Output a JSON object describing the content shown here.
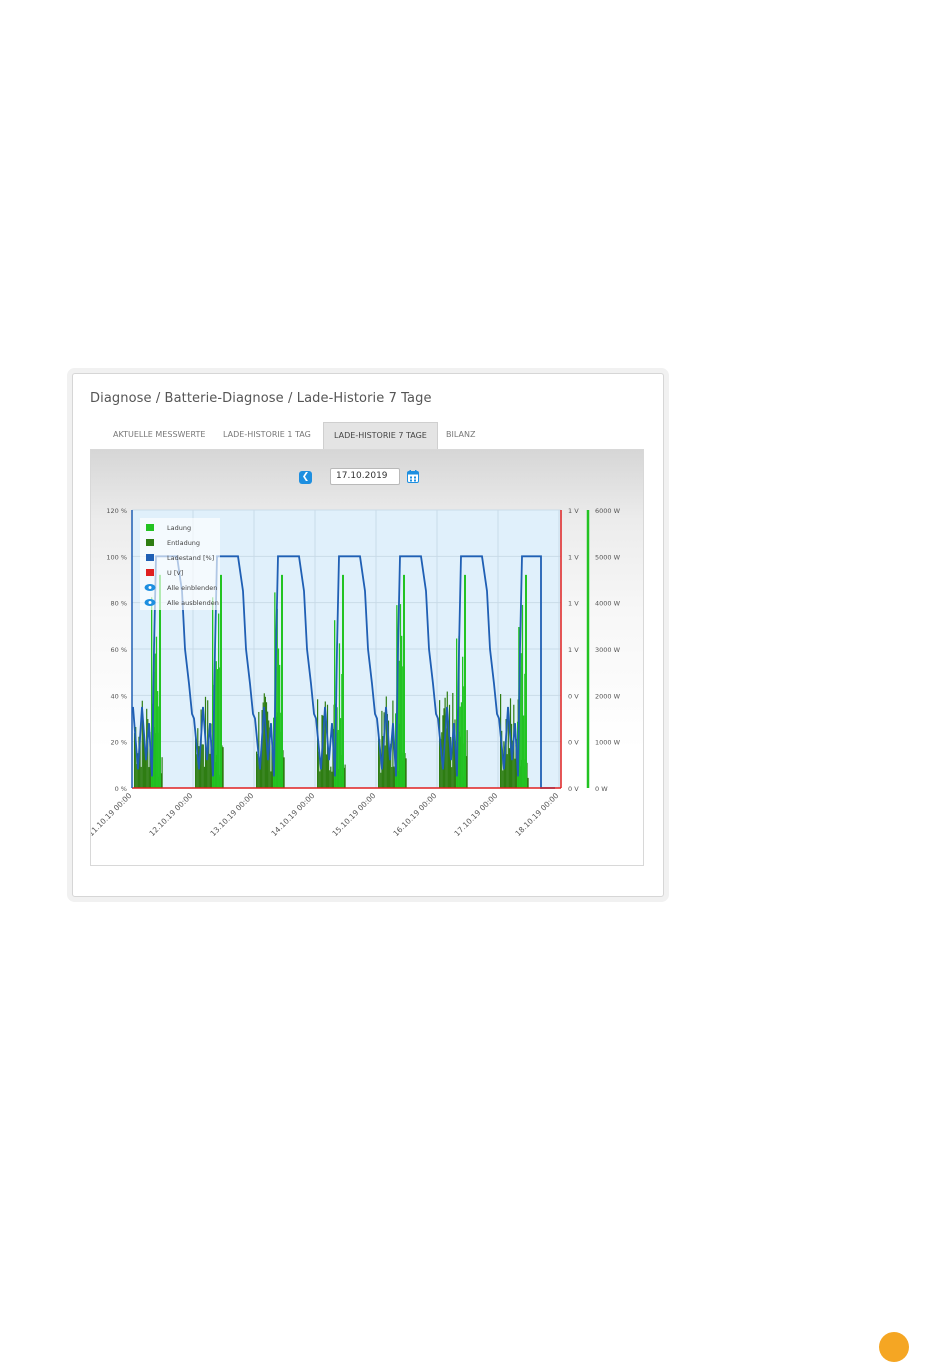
{
  "breadcrumb": "Diagnose / Batterie-Diagnose / Lade-Historie 7 Tage",
  "tabs": [
    {
      "label": "AKTUELLE MESSWERTE",
      "active": false
    },
    {
      "label": "LADE-HISTORIE 1 TAG",
      "active": false
    },
    {
      "label": "LADE-HISTORIE 7 TAGE",
      "active": true
    },
    {
      "label": "BILANZ",
      "active": false
    }
  ],
  "date_value": "17.10.2019",
  "icons": {
    "prev": "chevron-left-icon",
    "calendar": "calendar-icon"
  },
  "colors": {
    "ladung": "#22c322",
    "entladung": "#2e7d12",
    "ladestand": "#1f5fb4",
    "voltage": "#e02020",
    "accent": "#1e8fe0",
    "page_dot": "#f5a623"
  },
  "chart_data": {
    "type": "area",
    "x_tick_labels": [
      "11.10.19 00:00",
      "12.10.19 00:00",
      "13.10.19 00:00",
      "14.10.19 00:00",
      "15.10.19 00:00",
      "16.10.19 00:00",
      "17.10.19 00:00",
      "18.10.19 00:00"
    ],
    "axes": {
      "left": {
        "ticks": [
          "0 %",
          "20 %",
          "40 %",
          "60 %",
          "80 %",
          "100 %",
          "120 %"
        ],
        "range": [
          0,
          120
        ]
      },
      "right1": {
        "ticks": [
          "0 V",
          "0 V",
          "0 V",
          "1 V",
          "1 V",
          "1 V",
          "1 V"
        ]
      },
      "right2": {
        "ticks": [
          "0 W",
          "1000 W",
          "2000 W",
          "3000 W",
          "4000 W",
          "5000 W",
          "6000 W"
        ],
        "range": [
          0,
          6000
        ]
      }
    },
    "legend": {
      "placement": "top-left",
      "items": [
        {
          "label": "Ladung",
          "color": "#22c322"
        },
        {
          "label": "Entladung",
          "color": "#2e7d12"
        },
        {
          "label": "Ladestand [%]",
          "color": "#1f5fb4"
        },
        {
          "label": "U [V]",
          "color": "#e02020"
        }
      ],
      "actions": [
        "Alle einblenden",
        "Alle ausblenden"
      ]
    },
    "series": [
      {
        "name": "Ladestand [%]",
        "axis": "left",
        "shape": "daily cycle: charges to 100 % midday, discharges to ~10 % overnight",
        "peak": 100,
        "min": 5
      },
      {
        "name": "Ladung",
        "axis": "right2",
        "daily_peak_w": 5000
      },
      {
        "name": "Entladung",
        "axis": "right2",
        "daily_peak_w": 2100
      },
      {
        "name": "U [V]",
        "axis": "right1",
        "value_v": 0
      }
    ],
    "grid": true
  }
}
